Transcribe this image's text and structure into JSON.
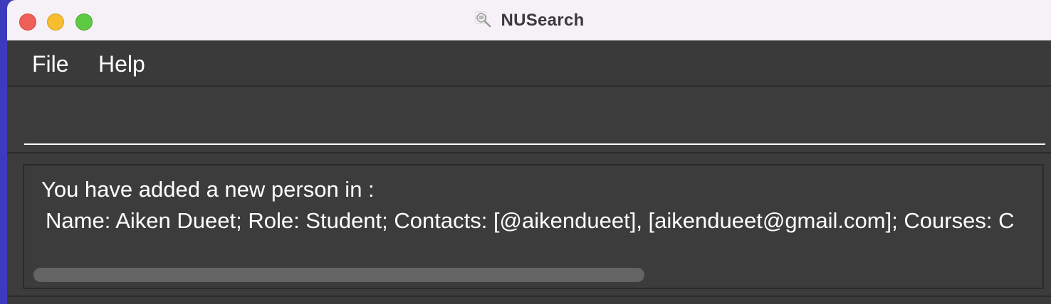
{
  "window": {
    "title": "NUSearch",
    "app_icon": "magnifier-icon"
  },
  "traffic_lights": {
    "close_color": "#ee5f57",
    "minimize_color": "#f6be2f",
    "zoom_color": "#5ec942"
  },
  "menubar": {
    "items": [
      {
        "label": "File"
      },
      {
        "label": "Help"
      }
    ]
  },
  "command_box": {
    "value": "",
    "placeholder": ""
  },
  "result_display": {
    "line1": "You have added a new person in :",
    "line2": "Name: Aiken Dueet; Role: Student; Contacts: [@aikendueet], [aikendueet@gmail.com]; Courses: C"
  },
  "theme": {
    "background": "#3c3c3c",
    "text": "#ffffff",
    "desktop": "#3d3bbd"
  }
}
